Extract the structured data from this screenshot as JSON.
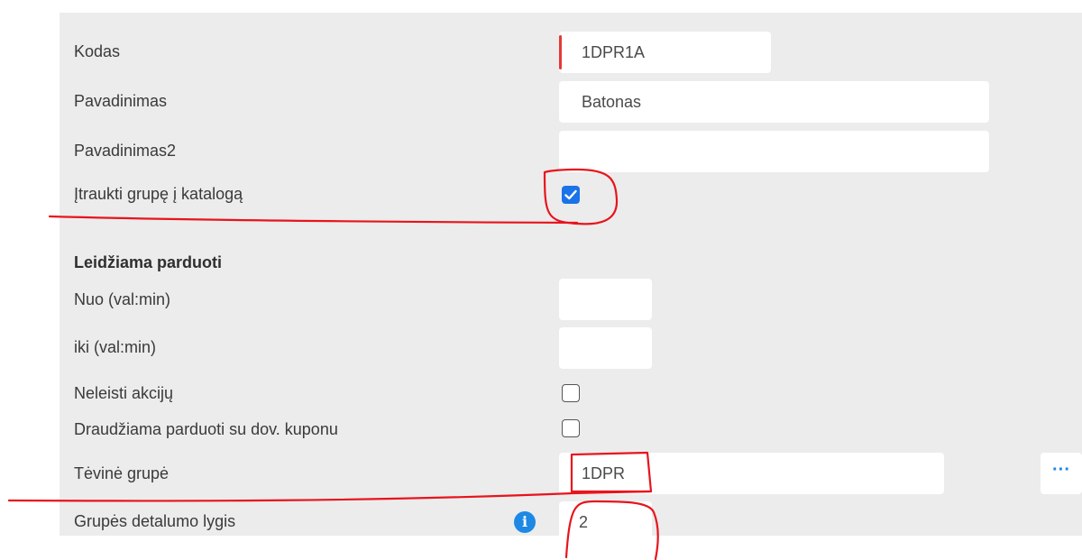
{
  "form": {
    "kodas": {
      "label": "Kodas",
      "value": "1DPR1A"
    },
    "pavadinimas": {
      "label": "Pavadinimas",
      "value": "Batonas"
    },
    "pavadinimas2": {
      "label": "Pavadinimas2",
      "value": ""
    },
    "itraukti": {
      "label": "Įtraukti grupę į katalogą",
      "checked": true
    },
    "section_title": "Leidžiama parduoti",
    "nuo": {
      "label": "Nuo (val:min)",
      "value": ""
    },
    "iki": {
      "label": "iki (val:min)",
      "value": ""
    },
    "neleisti_akciju": {
      "label": "Neleisti akcijų",
      "checked": false
    },
    "draudziama_kupon": {
      "label": "Draudžiama parduoti su dov. kuponu",
      "checked": false
    },
    "tevine_grupe": {
      "label": "Tėvinė grupė",
      "value": "1DPR",
      "button_label": "···"
    },
    "detalumo_lygis": {
      "label": "Grupės detalumo lygis",
      "value": "2",
      "info_glyph": "i"
    }
  },
  "colors": {
    "accent": "#1a73e8",
    "required_marker": "#e53935",
    "annotation_ink": "#e8141c",
    "panel_bg": "#ececec"
  }
}
